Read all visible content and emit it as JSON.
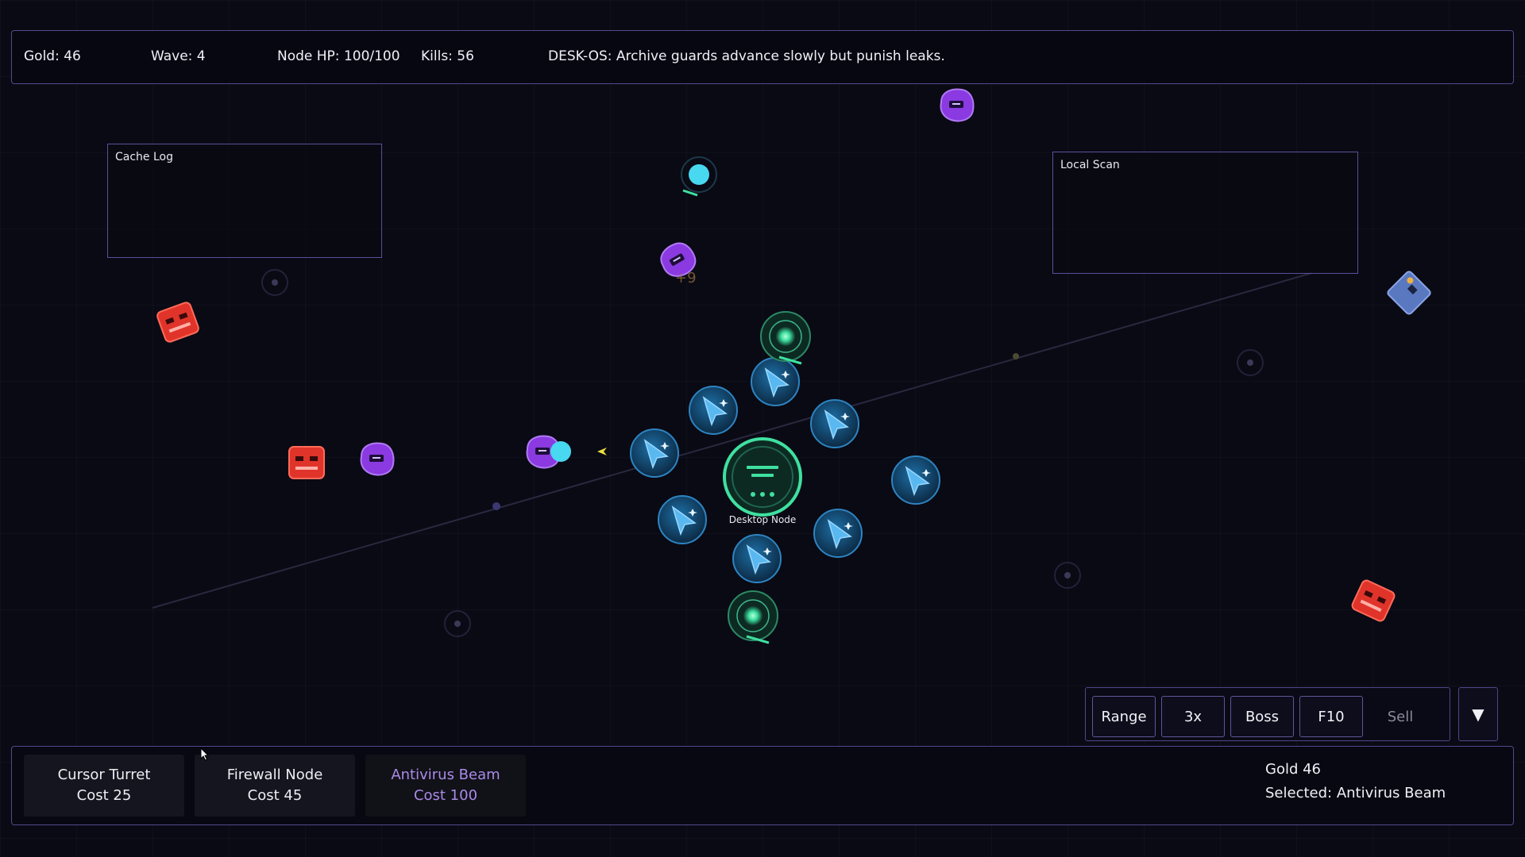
{
  "hud": {
    "gold": "Gold: 46",
    "wave": "Wave: 4",
    "node_hp": "Node HP: 100/100",
    "kills": "Kills: 56",
    "message": "DESK-OS: Archive guards advance slowly but punish leaks."
  },
  "panels": {
    "cache_log": "Cache Log",
    "local_scan": "Local Scan"
  },
  "core": {
    "label": "Desktop Node",
    "color": "#3fe0a0"
  },
  "floating_text": "+9",
  "controls": {
    "range": "Range",
    "speed": "3x",
    "boss": "Boss",
    "f10": "F10",
    "sell": "Sell",
    "toggle_icon": "▼"
  },
  "towers": [
    {
      "name": "Cursor Turret",
      "cost": "Cost 25"
    },
    {
      "name": "Firewall Node",
      "cost": "Cost 45"
    },
    {
      "name": "Antivirus Beam",
      "cost": "Cost 100"
    }
  ],
  "info": {
    "gold": "Gold 46",
    "selected": "Selected: Antivirus Beam"
  },
  "colors": {
    "accent": "#5a4f9a",
    "turret": "#3aa0e0",
    "beam": "#5cf0b0",
    "enemy_red": "#e0342a",
    "enemy_purple": "#8a3ae0",
    "enemy_blue": "#5a78c0",
    "selected_tower": "#a98be8"
  }
}
